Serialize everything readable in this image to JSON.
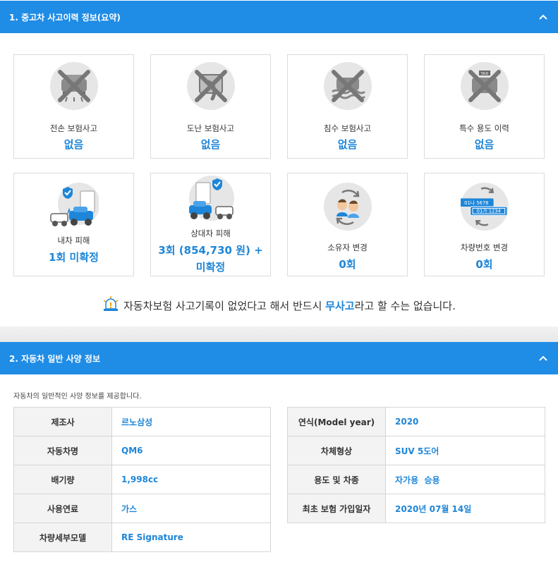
{
  "section1": {
    "title": "1. 중고차 사고이력 정보(요약)",
    "cards": [
      {
        "label": "전손 보험사고",
        "value": "없음",
        "icon": "total-loss-car-icon"
      },
      {
        "label": "도난 보험사고",
        "value": "없음",
        "icon": "theft-icon"
      },
      {
        "label": "침수 보험사고",
        "value": "없음",
        "icon": "flood-car-icon"
      },
      {
        "label": "특수 용도 이력",
        "value": "없음",
        "icon": "taxi-icon"
      },
      {
        "label": "내차 피해",
        "value_count": "1회",
        "value_extra": "미확정",
        "icon": "own-car-damage-icon"
      },
      {
        "label": "상대차 피해",
        "value_line1": "3회 (854,730 원) +",
        "value_line2": "미확정",
        "icon": "other-car-damage-icon"
      },
      {
        "label": "소유자 변경",
        "value": "0회",
        "icon": "owner-change-icon"
      },
      {
        "label": "차량번호 변경",
        "value": "0회",
        "icon": "plate-change-icon"
      }
    ],
    "plate_old": "01나 5678",
    "plate_new": "01가 1234",
    "taxi_text": "TAXI",
    "notice_pre": "자동차보험 사고기록이 없었다고 해서 반드시 ",
    "notice_em": "무사고",
    "notice_post": "라고 할 수는 없습니다."
  },
  "section2": {
    "title": "2. 자동차 일반 사양 정보",
    "description": "자동차의 일반적인 사양 정보를 제공합니다.",
    "left_rows": [
      {
        "key": "제조사",
        "value": "르노삼성"
      },
      {
        "key": "자동차명",
        "value": "QM6"
      },
      {
        "key": "배기량",
        "value": "1,998cc"
      },
      {
        "key": "사용연료",
        "value": "가스"
      },
      {
        "key": "차량세부모델",
        "value": "RE Signature"
      }
    ],
    "right_rows": [
      {
        "key": "연식(Model year)",
        "value": "2020"
      },
      {
        "key": "차체형상",
        "value": "SUV 5도어"
      },
      {
        "key": "용도 및 차종",
        "value": "자가용  승용"
      },
      {
        "key": "최초 보험 가입일자",
        "value": "2020년 07월 14일"
      }
    ]
  },
  "colors": {
    "header_blue": "#1f8ce6",
    "value_blue": "#1e86d8",
    "card_border": "#dcdcdc"
  }
}
